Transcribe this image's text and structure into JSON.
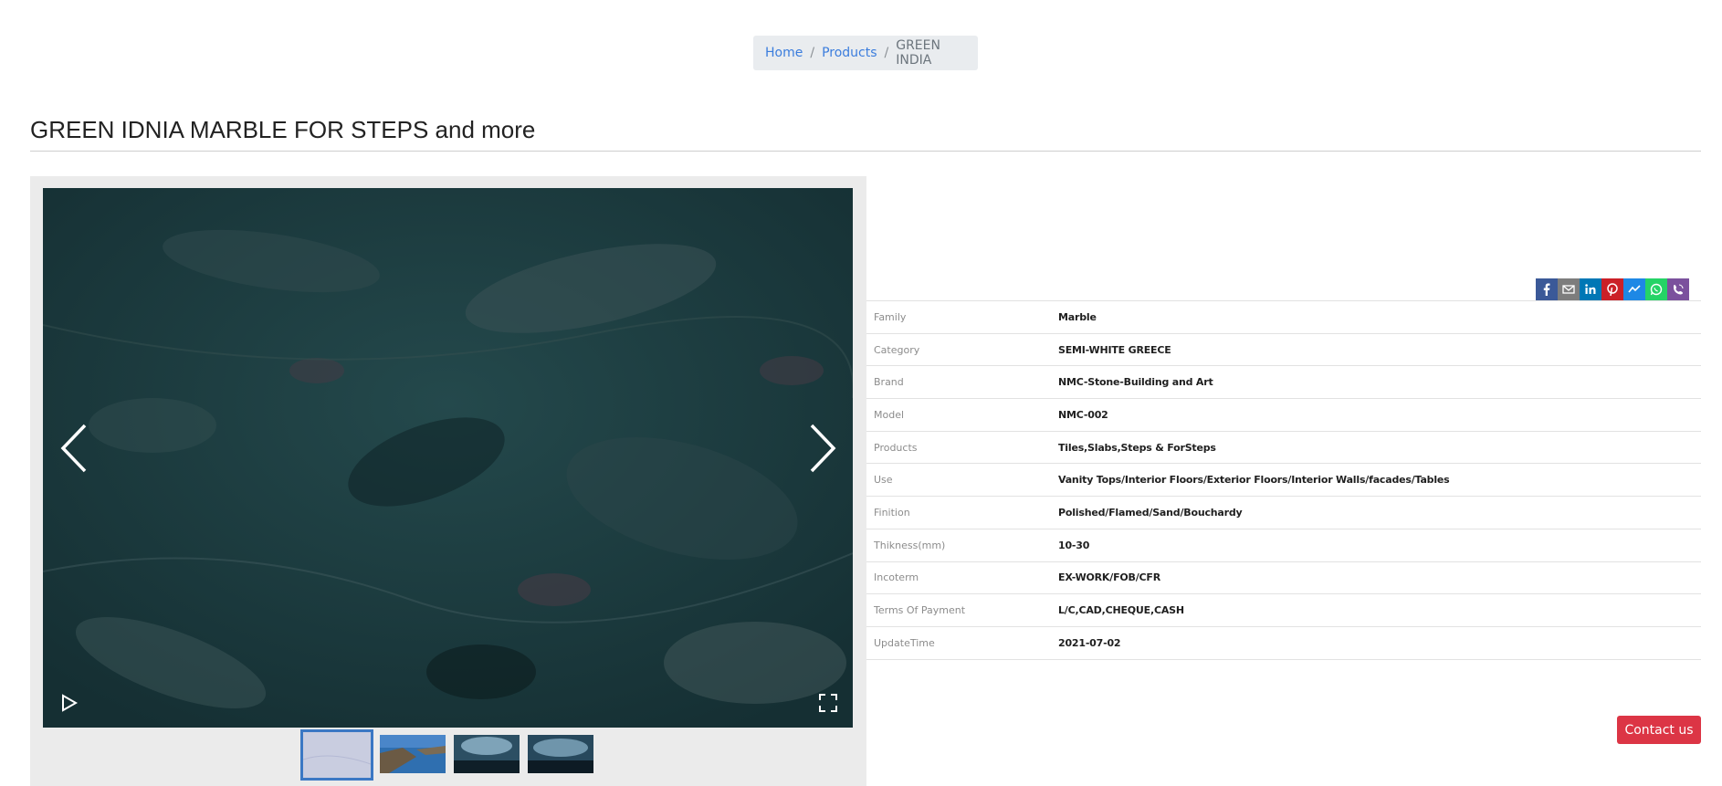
{
  "breadcrumb": {
    "home": "Home",
    "products": "Products",
    "current": "GREEN INDIA",
    "separator": "/"
  },
  "page_title": "GREEN IDNIA MARBLE FOR STEPS and more",
  "gallery": {
    "icons": [
      "chevron-left-icon",
      "chevron-right-icon",
      "play-icon",
      "fullscreen-icon"
    ],
    "thumbnail_count": 4,
    "active_thumbnail": 1
  },
  "share": {
    "icons": [
      {
        "name": "facebook-icon",
        "color": "#3b5998"
      },
      {
        "name": "email-icon",
        "color": "#7d7d7d"
      },
      {
        "name": "linkedin-icon",
        "color": "#0077b5"
      },
      {
        "name": "pinterest-icon",
        "color": "#cb2027"
      },
      {
        "name": "messenger-icon",
        "color": "#1e88e5"
      },
      {
        "name": "whatsapp-icon",
        "color": "#25d366"
      },
      {
        "name": "viber-icon",
        "color": "#7b519d"
      }
    ]
  },
  "specs": [
    {
      "label": "Family",
      "value": "Marble"
    },
    {
      "label": "Category",
      "value": "SEMI-WHITE GREECE"
    },
    {
      "label": "Brand",
      "value": "NMC-Stone-Building and Art"
    },
    {
      "label": "Model",
      "value": "NMC-002"
    },
    {
      "label": "Products",
      "value": "Tiles,Slabs,Steps & ForSteps"
    },
    {
      "label": "Use",
      "value": "Vanity Tops/Interior Floors/Exterior Floors/Interior Walls/facades/Tables"
    },
    {
      "label": "Finition",
      "value": "Polished/Flamed/Sand/Bouchardy"
    },
    {
      "label": "Thikness(mm)",
      "value": "10-30"
    },
    {
      "label": "Incoterm",
      "value": "EX-WORK/FOB/CFR"
    },
    {
      "label": "Terms Of Payment",
      "value": "L/C,CAD,CHEQUE,CASH"
    },
    {
      "label": "UpdateTime",
      "value": "2021-07-02"
    }
  ],
  "contact_button": "Contact us",
  "colors": {
    "accent_red": "#dc3545",
    "link_blue": "#3b7ddd",
    "marble_green": "#1e3f42"
  }
}
